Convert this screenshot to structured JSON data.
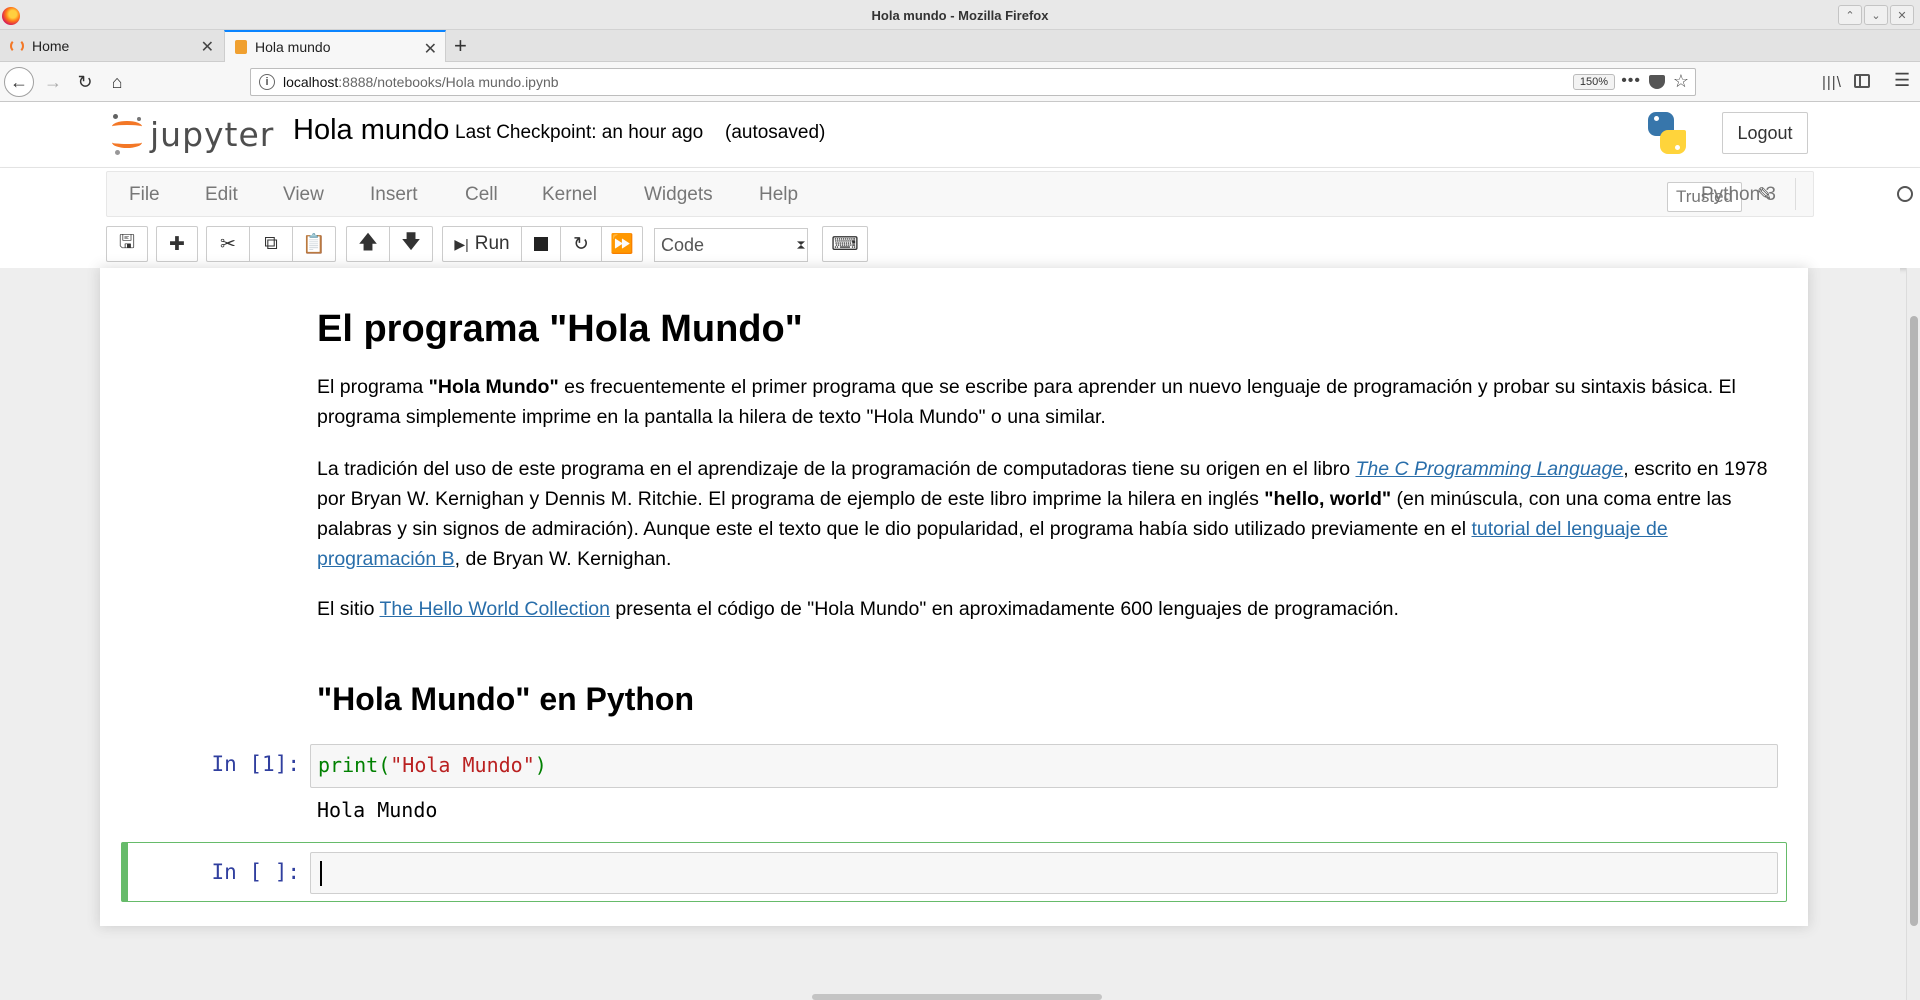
{
  "browser": {
    "window_title": "Hola mundo - Mozilla Firefox",
    "tabs": [
      {
        "label": "Home"
      },
      {
        "label": "Hola mundo"
      }
    ],
    "url_host": "localhost",
    "url_path": ":8888/notebooks/Hola mundo.ipynb",
    "zoom": "150%"
  },
  "jupyter": {
    "logo_text": "jupyter",
    "notebook_name": "Hola mundo",
    "checkpoint": "Last Checkpoint: an hour ago",
    "autosave": "(autosaved)",
    "logout_label": "Logout",
    "menu": [
      "File",
      "Edit",
      "View",
      "Insert",
      "Cell",
      "Kernel",
      "Widgets",
      "Help"
    ],
    "trusted_label": "Trusted",
    "kernel_name": "Python 3",
    "run_label": "Run",
    "cell_type": "Code"
  },
  "notebook": {
    "h1": "El programa \"Hola Mundo\"",
    "p1": {
      "a": "El programa ",
      "b": "\"Hola Mundo\"",
      "c": " es frecuentemente el primer programa que se escribe para aprender un nuevo lenguaje de programación y probar su sintaxis básica. El programa simplemente imprime en la pantalla la hilera de texto \"Hola Mundo\" o una similar."
    },
    "p2": {
      "a": "La tradición del uso de este programa en el aprendizaje de la programación de computadoras tiene su origen en el libro ",
      "link1": "The C Programming Language",
      "b": ", escrito en 1978 por Bryan W. Kernighan y Dennis M. Ritchie. El programa de ejemplo de este libro imprime la hilera en inglés ",
      "bold": "\"hello, world\"",
      "c": " (en minúscula, con una coma entre las palabras y sin signos de admiración). Aunque este el texto que le dio popularidad, el programa había sido utilizado previamente en el ",
      "link2": "tutorial del lenguaje de programación B",
      "d": ", de Bryan W. Kernighan."
    },
    "p3": {
      "a": "El sitio ",
      "link": "The Hello World Collection",
      "b": " presenta el código de \"Hola Mundo\" en aproximadamente 600 lenguajes de programación."
    },
    "h2": "\"Hola Mundo\" en Python",
    "cell1": {
      "prompt": "In [1]:",
      "code_fn": "print(",
      "code_str": "\"Hola Mundo\"",
      "code_end": ")",
      "output": "Hola Mundo"
    },
    "cell2": {
      "prompt": "In [ ]:"
    }
  }
}
